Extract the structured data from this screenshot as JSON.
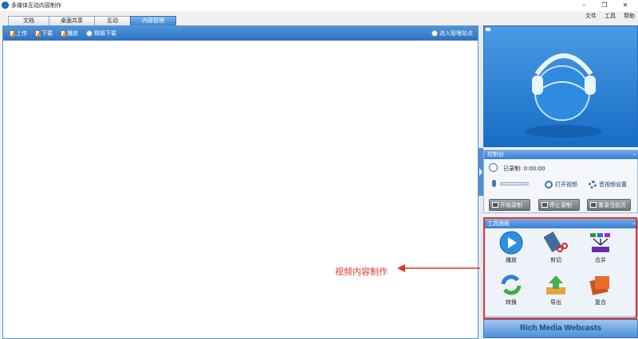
{
  "window": {
    "title": "多媒体互动内容制作",
    "minimize": "–",
    "maximize": "❐",
    "close": "✕"
  },
  "menu": [
    "文件",
    "工具",
    "帮助"
  ],
  "tabs": [
    {
      "label": "文档"
    },
    {
      "label": "桌面共享"
    },
    {
      "label": "互动"
    },
    {
      "label": "内容管理",
      "active": true
    }
  ],
  "toolbar": {
    "upload": "上传",
    "download": "下载",
    "play": "播放",
    "cut_download": "精辑下载",
    "admin": "进入管理站点"
  },
  "control_panel": {
    "title": "控制台",
    "minimize": "–",
    "recorded_label": "已录制: 0:00:00",
    "open_video": "打开视频",
    "av_settings": "音视频设置",
    "start_record": "开始录制",
    "stop_record": "停止录制",
    "rerecord": "重录当前页"
  },
  "tools_panel": {
    "title": "工具面板",
    "minimize": "–",
    "items": [
      "播放",
      "剪切",
      "合并",
      "转换",
      "导出",
      "复合"
    ]
  },
  "brand": "Rich Media Webcasts",
  "annotation": "视频内容制作",
  "colors": {
    "accent": "#3a7fcf",
    "highlight": "#e0352d"
  }
}
